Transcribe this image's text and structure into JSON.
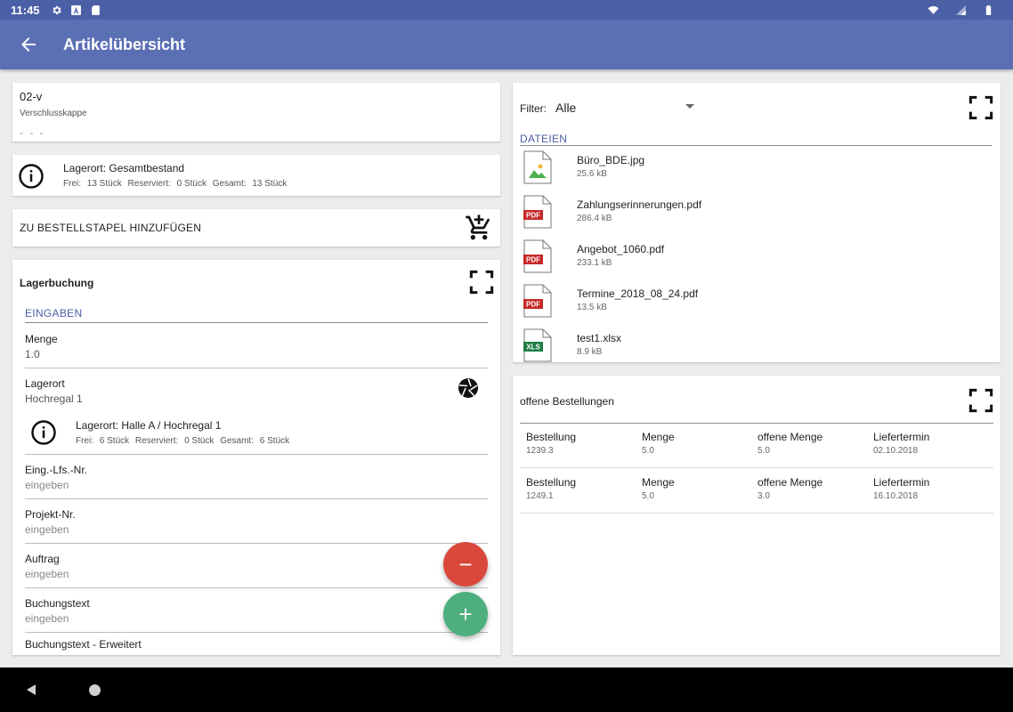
{
  "status_bar": {
    "time": "11:45"
  },
  "app_bar": {
    "title": "Artikelübersicht"
  },
  "article": {
    "code": "02-v",
    "description": "Verschlusskappe",
    "extra": "- - -"
  },
  "stock_total": {
    "line1": "Lagerort:  Gesamtbestand",
    "free_label": "Frei:",
    "free_value": "13 Stück",
    "reserved_label": "Reserviert:",
    "reserved_value": "0 Stück",
    "total_label": "Gesamt:",
    "total_value": "13 Stück"
  },
  "order_stack": {
    "label": "ZU BESTELLSTAPEL HINZUFÜGEN"
  },
  "booking": {
    "title": "Lagerbuchung",
    "section": "EINGABEN",
    "fields": [
      {
        "label": "Menge",
        "value": "1.0"
      },
      {
        "label": "Lagerort",
        "value": "Hochregal 1"
      },
      {
        "label": "Eing.-Lfs.-Nr.",
        "value": "eingeben"
      },
      {
        "label": "Projekt-Nr.",
        "value": "eingeben"
      },
      {
        "label": "Auftrag",
        "value": "eingeben"
      },
      {
        "label": "Buchungstext",
        "value": "eingeben"
      },
      {
        "label": "Buchungstext - Erweitert",
        "value": ""
      }
    ],
    "location_stock": {
      "line1": "Lagerort:  Halle A / Hochregal 1",
      "free_label": "Frei:",
      "free_value": "6 Stück",
      "reserved_label": "Reserviert:",
      "reserved_value": "0 Stück",
      "total_label": "Gesamt:",
      "total_value": "6 Stück"
    },
    "minus_label": "−",
    "plus_label": "+"
  },
  "files": {
    "filter_label": "Filter:",
    "filter_value": "Alle",
    "section": "DATEIEN",
    "items": [
      {
        "name": "Büro_BDE.jpg",
        "size": "25.6 kB",
        "type": "image"
      },
      {
        "name": "Zahlungserinnerungen.pdf",
        "size": "286.4 kB",
        "type": "pdf"
      },
      {
        "name": "Angebot_1060.pdf",
        "size": "233.1 kB",
        "type": "pdf"
      },
      {
        "name": "Termine_2018_08_24.pdf",
        "size": "13.5 kB",
        "type": "pdf"
      },
      {
        "name": "test1.xlsx",
        "size": "8.9 kB",
        "type": "xls"
      }
    ],
    "pdf_badge": "PDF",
    "xls_badge": "XLS"
  },
  "open_orders": {
    "title": "offene Bestellungen",
    "columns": [
      "Bestellung",
      "Menge",
      "offene Menge",
      "Liefertermin"
    ],
    "rows": [
      [
        "1239.3",
        "5.0",
        "5.0",
        "02.10.2018"
      ],
      [
        "1249.1",
        "5.0",
        "3.0",
        "16.10.2018"
      ]
    ]
  },
  "colors": {
    "primary": "#5b6fb5",
    "status_bar": "#4b5fa6",
    "accent": "#4b5fa6",
    "fab_minus": "#d9483b",
    "fab_plus": "#4caf7d",
    "pdf_red": "#c62828",
    "xls_green": "#1e7e45"
  },
  "icons": {
    "back": "arrow-back-icon",
    "info": "info-circle-icon",
    "cart": "add-shopping-cart-icon",
    "fullscreen": "fullscreen-icon",
    "camera": "camera-shutter-icon"
  }
}
